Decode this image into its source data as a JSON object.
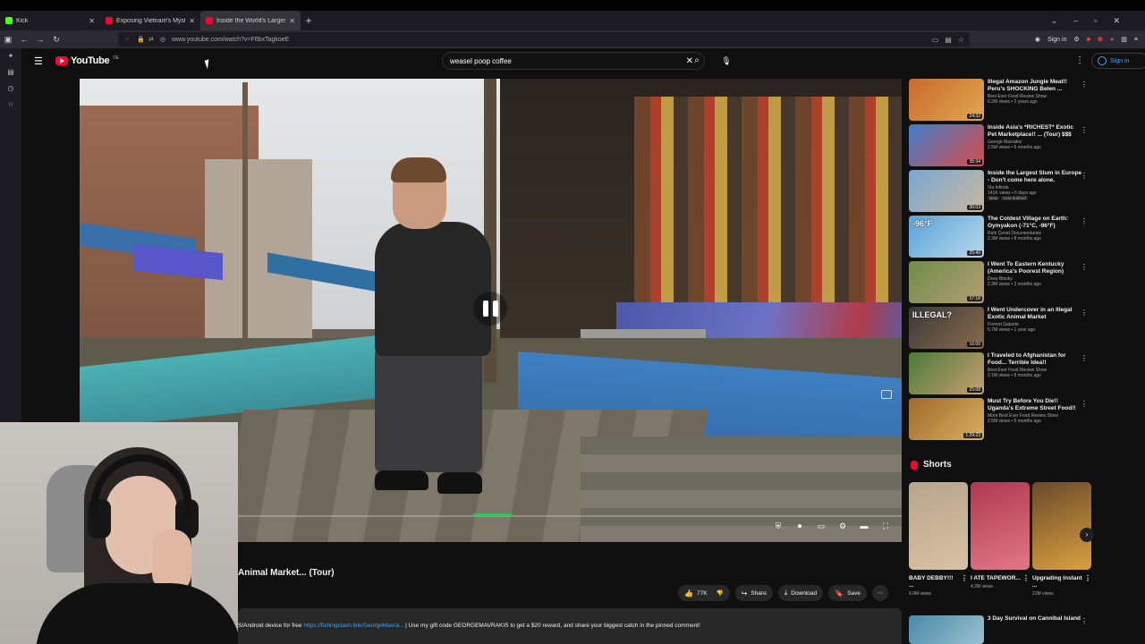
{
  "browser": {
    "tabs": [
      {
        "title": "Kick",
        "favicon": "kick",
        "active": false
      },
      {
        "title": "Exposing Vietnam's Mystery M",
        "favicon": "yt",
        "active": false
      },
      {
        "title": "Inside the World's Largest",
        "favicon": "yt",
        "active": true
      }
    ],
    "url": "www.youtube.com/watch?v=F6bxTagkoeE",
    "sign_in_label": "Sign in"
  },
  "header": {
    "logo_word": "YouTube",
    "logo_country": "DE",
    "search_value": "weasel poop coffee",
    "sign_in_label": "Sign in"
  },
  "video": {
    "title": "Animal Market... (Tour)",
    "likes": "77K",
    "share_label": "Share",
    "download_label": "Download",
    "save_label": "Save",
    "desc_prefix": "S/Android device for free",
    "desc_link": "https://fishingclash.link/GeorgeMavra...",
    "desc_suffix": "| Use my gift code GEORGEMAVRAKIS to get a $20 reward, and share your biggest catch in the pinned comment!",
    "progress_fraction": 0.0
  },
  "recommendations": [
    {
      "title": "Illegal Amazon Jungle Meat!! Peru's SHOCKING Belen ...",
      "channel": "Best Ever Food Review Show",
      "meta": "6.2M views • 2 years ago",
      "duration": "24:32",
      "colors": [
        "#c96a2c",
        "#e0a850"
      ]
    },
    {
      "title": "Inside Asia's *RICHEST* Exotic Pet Marketplace!! ... (Tour) $$$",
      "channel": "George Mavrakis",
      "meta": "2.5M views • 6 months ago",
      "duration": "35:34",
      "colors": [
        "#3f7ec9",
        "#d64a4a"
      ]
    },
    {
      "title": "Inside the Largest Slum in Europe - Don't come here alone.",
      "channel": "Via Infinda",
      "meta": "141K views • 6 days ago",
      "duration": "30:03",
      "badge": "New",
      "badge2": "Auto-dubbed",
      "colors": [
        "#7aa6d6",
        "#c9b89c"
      ]
    },
    {
      "title": "The Coldest Village on Earth: Oymyakon (-71°C, -96°F)",
      "channel": "Ruhi Çenet Documentaries",
      "meta": "2.3M views • 8 months ago",
      "duration": "25:40",
      "overlay": "-96°F",
      "colors": [
        "#5aa3d8",
        "#b8d6ea"
      ]
    },
    {
      "title": "I Went To Eastern Kentucky (America's Poorest Region)",
      "channel": "Drew Binsky",
      "meta": "2.3M views • 2 months ago",
      "duration": "37:18",
      "colors": [
        "#6e8c4a",
        "#b59e74"
      ]
    },
    {
      "title": "I Went Undercover in an Illegal Exotic Animal Market",
      "channel": "Forrest Galante",
      "meta": "5.7M views • 1 year ago",
      "duration": "16:00",
      "overlay": "ILLEGAL?",
      "colors": [
        "#3a3a3a",
        "#8a6a4a"
      ]
    },
    {
      "title": "I Traveled to Afghanistan for Food... Terrible Idea!!",
      "channel": "Best Ever Food Review Show",
      "meta": "2.1M views • 8 months ago",
      "duration": "25:08",
      "colors": [
        "#4a7a3a",
        "#c9a070"
      ]
    },
    {
      "title": "Must Try Before You Die!! Uganda's Extreme Street Food!!",
      "channel": "More Best Ever Food Review Show",
      "meta": "2.5M views • 5 months ago",
      "duration": "1:29:23",
      "colors": [
        "#a06a2c",
        "#d9b060"
      ]
    }
  ],
  "shorts": {
    "heading": "Shorts",
    "items": [
      {
        "title": "BABY DEBBY!!! ...",
        "views": "6.9M views",
        "colors": [
          "#b8a48e",
          "#d9c2a2"
        ]
      },
      {
        "title": "I ATE TAPEWOR...",
        "views": "4.2M views",
        "colors": [
          "#b03850",
          "#e07888"
        ]
      },
      {
        "title": "Upgrading Instant ...",
        "views": "21M views",
        "colors": [
          "#6a4a2a",
          "#d9a040"
        ]
      }
    ]
  },
  "bottom_rec": {
    "title": "3 Day Survival on Cannibal Island",
    "colors": [
      "#4a8aa8",
      "#9ac0d0"
    ]
  }
}
